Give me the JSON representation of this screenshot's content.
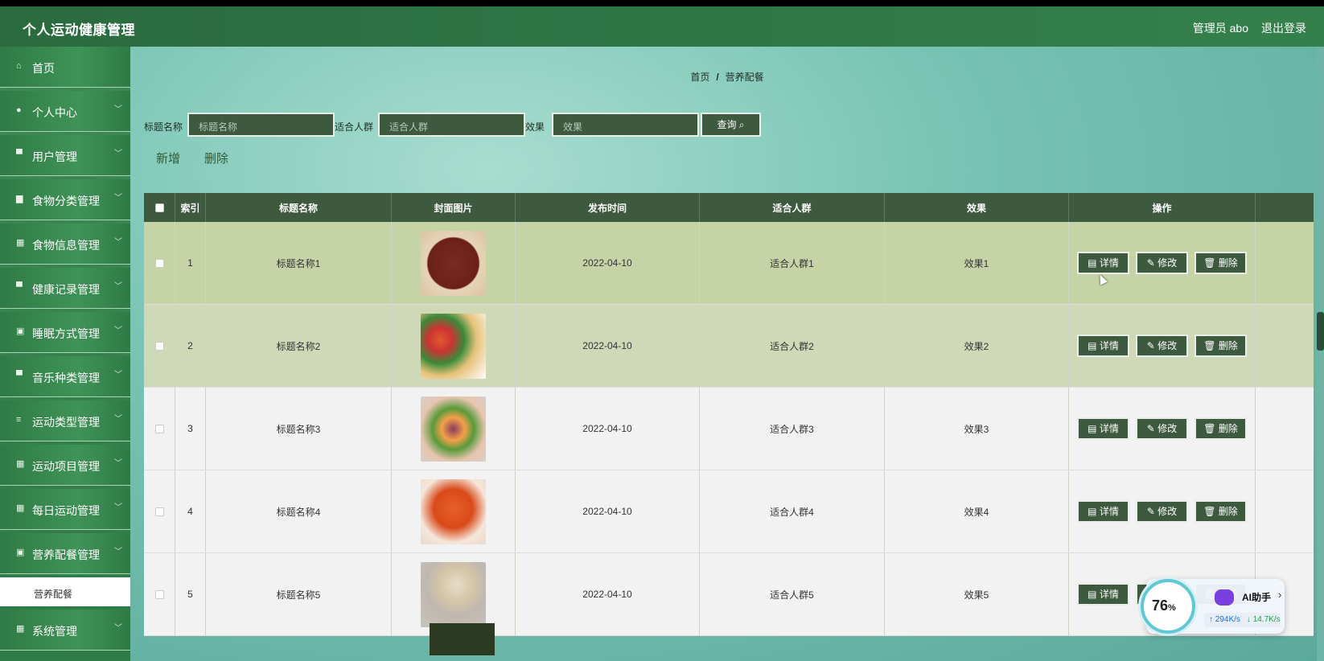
{
  "header": {
    "title": "个人运动健康管理",
    "user": "管理员 abo",
    "logout": "退出登录"
  },
  "sidebar": {
    "items": [
      {
        "label": "首页",
        "icon": "home-icon",
        "glyph": "⌂",
        "expandable": false
      },
      {
        "label": "个人中心",
        "icon": "user-icon",
        "glyph": "●",
        "expandable": true
      },
      {
        "label": "用户管理",
        "icon": "monitor-icon",
        "glyph": "▀",
        "expandable": true
      },
      {
        "label": "食物分类管理",
        "icon": "bag-icon",
        "glyph": "▆",
        "expandable": true
      },
      {
        "label": "食物信息管理",
        "icon": "grid-icon",
        "glyph": "▦",
        "expandable": true
      },
      {
        "label": "健康记录管理",
        "icon": "monitor-icon",
        "glyph": "▀",
        "expandable": true
      },
      {
        "label": "睡眠方式管理",
        "icon": "clipboard-icon",
        "glyph": "▣",
        "expandable": true
      },
      {
        "label": "音乐种类管理",
        "icon": "chat-icon",
        "glyph": "▀",
        "expandable": true
      },
      {
        "label": "运动类型管理",
        "icon": "list-icon",
        "glyph": "≡",
        "expandable": true
      },
      {
        "label": "运动项目管理",
        "icon": "grid-icon",
        "glyph": "▦",
        "expandable": true
      },
      {
        "label": "每日运动管理",
        "icon": "grid-icon",
        "glyph": "▦",
        "expandable": true
      },
      {
        "label": "营养配餐管理",
        "icon": "clipboard-icon",
        "glyph": "▣",
        "expandable": true
      }
    ],
    "subitem": "营养配餐",
    "last": {
      "label": "系统管理",
      "icon": "grid-icon",
      "glyph": "▦"
    },
    "chevron": "﹀"
  },
  "breadcrumb": {
    "home": "首页",
    "sep": "/",
    "current": "营养配餐"
  },
  "search": {
    "title_label": "标题名称",
    "title_placeholder": "标题名称",
    "crowd_label": "适合人群",
    "crowd_placeholder": "适合人群",
    "effect_label": "效果",
    "effect_placeholder": "效果",
    "query_button": "查询 ⌕"
  },
  "actions": {
    "add": "新增",
    "delete": "删除"
  },
  "table": {
    "columns": [
      "",
      "索引",
      "标题名称",
      "封面图片",
      "发布时间",
      "适合人群",
      "效果",
      "操作"
    ],
    "rows": [
      {
        "index": "1",
        "title": "标题名称1",
        "date": "2022-04-10",
        "crowd": "适合人群1",
        "effect": "效果1"
      },
      {
        "index": "2",
        "title": "标题名称2",
        "date": "2022-04-10",
        "crowd": "适合人群2",
        "effect": "效果2"
      },
      {
        "index": "3",
        "title": "标题名称3",
        "date": "2022-04-10",
        "crowd": "适合人群3",
        "effect": "效果3"
      },
      {
        "index": "4",
        "title": "标题名称4",
        "date": "2022-04-10",
        "crowd": "适合人群4",
        "effect": "效果4"
      },
      {
        "index": "5",
        "title": "标题名称5",
        "date": "2022-04-10",
        "crowd": "适合人群5",
        "effect": "效果5"
      }
    ],
    "ops": {
      "detail": "▤ 详情",
      "edit": "✎ 修改",
      "delete": "🗑 删除"
    }
  },
  "ai_widget": {
    "percent": "76",
    "pct_sign": "%",
    "label": "AI助手",
    "arrow": "›",
    "up": "↑ 294K/s",
    "down": "↓ 14.7K/s"
  },
  "colors": {
    "header": "#2a6b3e",
    "sidebar": "#3e8a55",
    "dark_green": "#3d5a3f",
    "accent_ring": "#62c7d4"
  }
}
